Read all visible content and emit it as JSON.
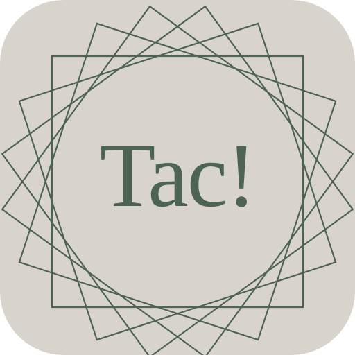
{
  "app_icon": {
    "wordmark": "Tac!",
    "colors": {
      "background": "#d8d4cc",
      "accent": "#4d6450"
    },
    "ornament": {
      "shape": "star-of-squares",
      "square_count": 5
    }
  }
}
